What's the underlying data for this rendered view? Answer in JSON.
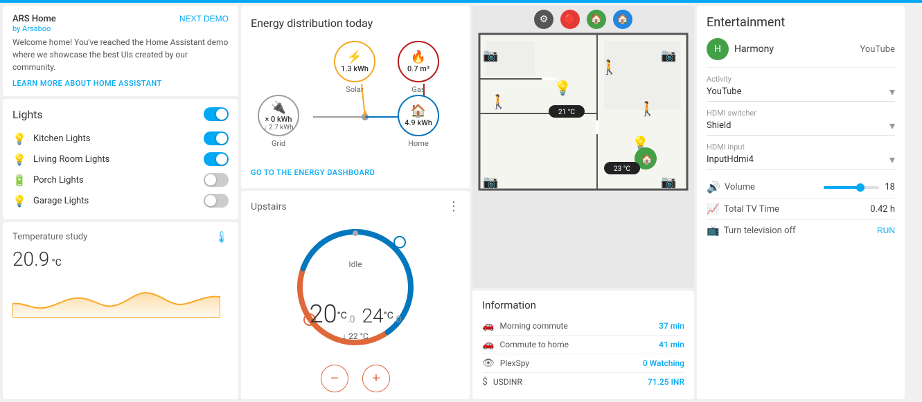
{
  "topbar": {
    "color": "#03a9f4"
  },
  "welcome": {
    "title": "ARS Home",
    "by": "by Arsaboo",
    "next_demo": "NEXT DEMO",
    "body": "Welcome home! You've reached the Home Assistant demo where we showcase the best UIs created by our community.",
    "learn_more": "LEARN MORE ABOUT HOME ASSISTANT"
  },
  "lights": {
    "section_title": "Lights",
    "items": [
      {
        "name": "Kitchen Lights",
        "icon": "💡",
        "color": "#f9a825",
        "on": true
      },
      {
        "name": "Living Room Lights",
        "icon": "💡",
        "color": "#f9a825",
        "on": true
      },
      {
        "name": "Porch Lights",
        "icon": "🔋",
        "color": "#1565c0",
        "on": false
      },
      {
        "name": "Garage Lights",
        "icon": "💡",
        "color": "#555",
        "on": false
      }
    ]
  },
  "temperature": {
    "label": "Temperature study",
    "value": "20.9",
    "unit": "°C"
  },
  "energy": {
    "title": "Energy distribution today",
    "nodes": {
      "solar": {
        "label": "Solar",
        "value": "1.3 kWh",
        "icon": "⚡"
      },
      "gas": {
        "label": "Gas",
        "value": "0.7 m³",
        "icon": "🔥"
      },
      "grid": {
        "label": "Grid",
        "value1": "× 0 kWh",
        "value2": "↓ 2.7 kWh",
        "icon": "🔌"
      },
      "home": {
        "label": "Home",
        "value": "4.9 kWh",
        "icon": "🏠"
      }
    },
    "link": "GO TO THE ENERGY DASHBOARD"
  },
  "thermostat": {
    "title": "Upstairs",
    "status": "Idle",
    "current_temp": "20",
    "set_temp": "24",
    "unit": "°C",
    "sub": ".0",
    "setpoint": "↓ 22 °C",
    "minus_label": "−",
    "plus_label": "+"
  },
  "floorplan": {
    "icons": [
      "⚙",
      "🟥",
      "🏠",
      "🏠"
    ],
    "temp_badges": [
      {
        "value": "21 °C"
      },
      {
        "value": "23 °C"
      }
    ]
  },
  "information": {
    "title": "Information",
    "items": [
      {
        "icon": "🚗",
        "label": "Morning commute",
        "value": "37 min"
      },
      {
        "icon": "🚗",
        "label": "Commute to home",
        "value": "41 min"
      },
      {
        "icon": "👁",
        "label": "PlexSpy",
        "value": "0 Watching"
      },
      {
        "icon": "$",
        "label": "USDINR",
        "value": "71.25 INR"
      }
    ]
  },
  "entertainment": {
    "title": "Entertainment",
    "harmony_name": "Harmony",
    "harmony_status": "YouTube",
    "activity_label": "Activity",
    "activity_value": "YouTube",
    "hdmi_switcher_label": "HDMI switcher",
    "hdmi_switcher_value": "Shield",
    "hdmi_input_label": "HDMI input",
    "hdmi_input_value": "InputHdmi4",
    "volume_label": "Volume",
    "volume_value": "18",
    "tv_time_label": "Total TV Time",
    "tv_time_value": "0.42 h",
    "tv_off_label": "Turn television off",
    "run_label": "RUN"
  }
}
